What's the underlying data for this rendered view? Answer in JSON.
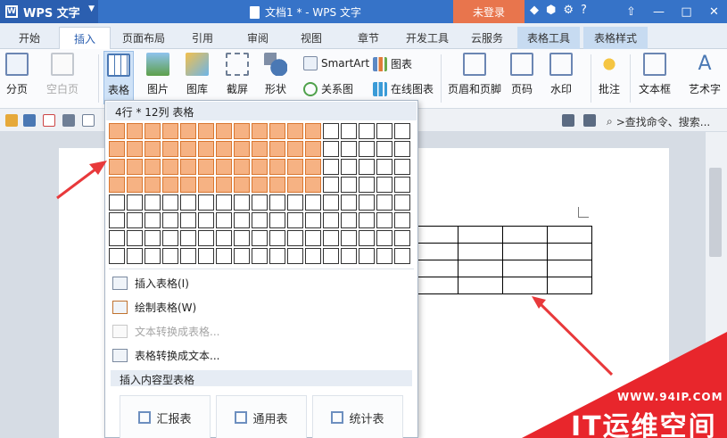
{
  "titlebar": {
    "app_name": "WPS 文字",
    "doc_title": "文档1 * - WPS 文字",
    "login": "未登录"
  },
  "tabs": [
    "开始",
    "插入",
    "页面布局",
    "引用",
    "审阅",
    "视图",
    "章节",
    "开发工具",
    "云服务",
    "表格工具",
    "表格样式"
  ],
  "active_tab": "插入",
  "ribbon": {
    "page_break": "分页",
    "blank_page": "空白页",
    "table": "表格",
    "picture": "图片",
    "gallery": "图库",
    "screenshot": "截屏",
    "shape": "形状",
    "smartart": "SmartArt",
    "chart": "图表",
    "relation": "关系图",
    "online_chart": "在线图表",
    "header_footer": "页眉和页脚",
    "page_number": "页码",
    "watermark": "水印",
    "comment": "批注",
    "textbox": "文本框",
    "art_text": "艺术字"
  },
  "search": {
    "text": ">查找命令、搜索..."
  },
  "table_menu": {
    "header": "4行 * 12列 表格",
    "selected_rows": 4,
    "selected_cols": 12,
    "total_rows": 8,
    "total_cols": 17,
    "items": [
      "插入表格(I)",
      "绘制表格(W)",
      "文本转换成表格...",
      "表格转换成文本..."
    ],
    "disabled_index": 2,
    "subheader": "插入内容型表格",
    "templates": [
      "汇报表",
      "通用表",
      "统计表"
    ]
  },
  "watermark": {
    "url": "WWW.94IP.COM",
    "text": "IT运维空间"
  },
  "colors": {
    "title_bar": "#3673c8",
    "selection": "#f6b283",
    "login": "#e8754d",
    "watermark": "#e8262c"
  }
}
